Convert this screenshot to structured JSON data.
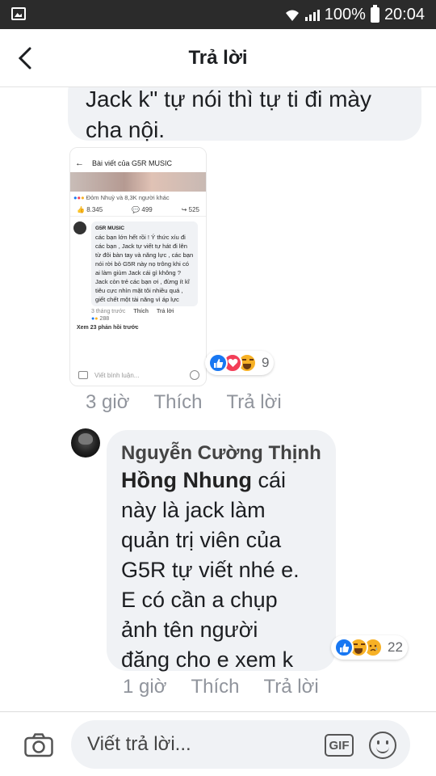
{
  "status_bar": {
    "battery_percent": "100%",
    "time": "20:04",
    "icons": [
      "gallery-icon",
      "wifi-icon",
      "signal-icon",
      "battery-icon"
    ]
  },
  "header": {
    "title": "Trả lời",
    "back_icon": "chevron-left-icon"
  },
  "comment_top": {
    "text_line1": "Jack k\" tự nói thì tự ti đi mày",
    "text_line2": "cha nội."
  },
  "screenshot_image": {
    "page_title": "Bài viết của G5R MUSIC",
    "reactions_line": "Đỏm Nhuỳ và 8,3K người khác",
    "likes": "8.345",
    "comments": "499",
    "shares": "525",
    "comment_author": "G5R MUSIC",
    "comment_text": "các bạn lớn hết rồi ! Ý thức xíu đi các bạn , Jack tự viết tự hát đi lên từ đôi bàn tay và năng lực , các bạn nói rời bỏ G5R này nọ trông khi có ai làm giùm Jack cái gì không ? Jack còn trẻ các bạn ơi , đừng ít kĩ tiêu cực nhìn mặt tôi nhiều quá , giết chết một tài năng vì áp lực",
    "comment_time": "3 tháng trước",
    "comment_like": "Thích",
    "comment_reply": "Trả lời",
    "comment_reactions": "288",
    "view_more": "Xem 23 phản hồi trước",
    "input_placeholder": "Viết bình luận..."
  },
  "comment_top_reactions": {
    "types": [
      "like",
      "love",
      "haha"
    ],
    "count": "9"
  },
  "comment_top_actions": {
    "time": "3 giờ",
    "like": "Thích",
    "reply": "Trả lời"
  },
  "reply": {
    "author": "Nguyễn Cường Thịnh",
    "mention": "Hồng Nhung",
    "line1_rest": " cái",
    "line2": "này là jack làm",
    "line3": "quản trị viên của",
    "line4": "G5R tự viết nhé e.",
    "line5": "E có cần a chụp",
    "line6": "ảnh tên người",
    "line7": "đăng cho e xem k"
  },
  "reply_reactions": {
    "types": [
      "like",
      "haha",
      "sad"
    ],
    "count": "22"
  },
  "reply_actions": {
    "time": "1 giờ",
    "like": "Thích",
    "reply": "Trả lời"
  },
  "composer": {
    "placeholder": "Viết trả lời...",
    "gif_label": "GIF"
  }
}
